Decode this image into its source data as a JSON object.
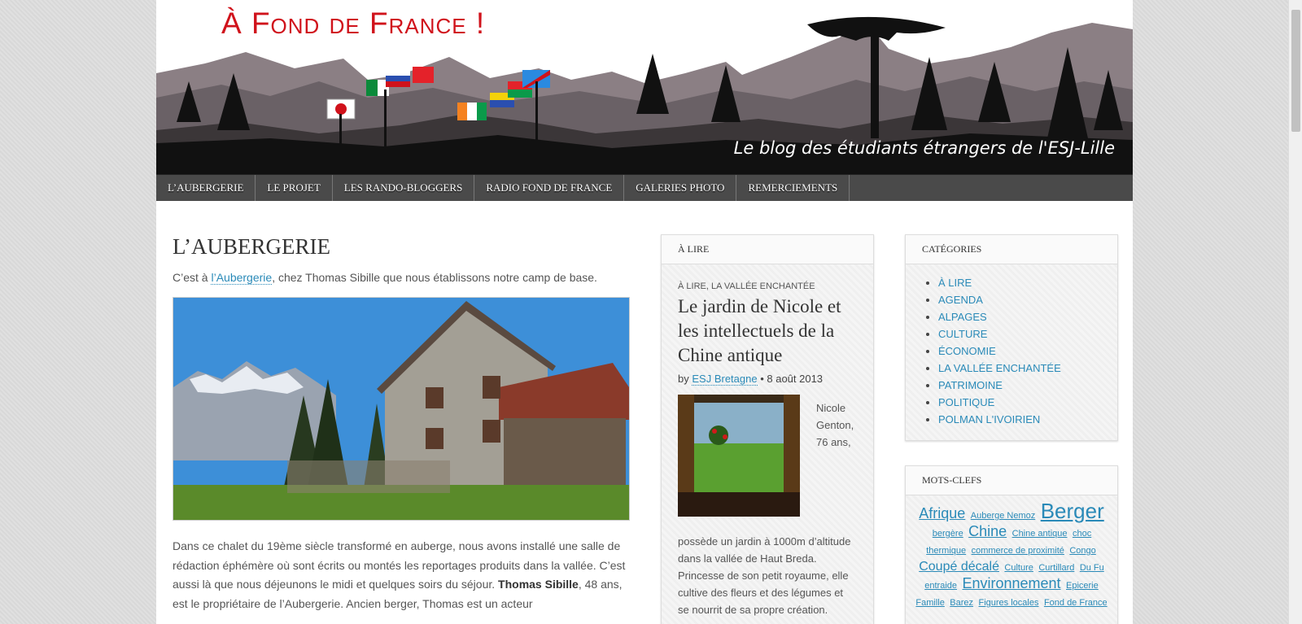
{
  "site": {
    "title": "À Fond de France !",
    "tagline": "Le blog des étudiants étrangers de l'ESJ-Lille"
  },
  "nav": [
    "L’AUBERGERIE",
    "LE PROJET",
    "LES RANDO-BLOGGERS",
    "RADIO FOND DE FRANCE",
    "GALERIES PHOTO",
    "REMERCIEMENTS"
  ],
  "article": {
    "title": "L’AUBERGERIE",
    "intro_before": "C’est à ",
    "intro_link": "l’Aubergerie",
    "intro_after": ", chez Thomas Sibille que nous établissons notre camp de base.",
    "body_1": "Dans ce chalet du 19ème siècle transformé en auberge, nous avons installé une salle de rédaction éphémère où sont écrits ou montés les reportages produits dans la vallée. C’est aussi là que nous déjeunons le midi et quelques soirs du séjour. ",
    "body_bold": "Thomas Sibille",
    "body_2": ", 48 ans, est le propriétaire de l’Aubergerie. Ancien berger, Thomas est un acteur"
  },
  "widget_lire": {
    "title": "À LIRE",
    "categories": "À LIRE, LA VALLÉE ENCHANTÉE",
    "post_title": "Le jardin de Nicole et les intellectuels de la Chine antique",
    "by": "by",
    "author": "ESJ Bretagne",
    "date": "• 8 août 2013",
    "excerpt_side": "Nicole Genton, 76 ans,",
    "excerpt_rest": "possède un jardin à 1000m d’altitude dans la vallée de Haut Breda. Princesse de son petit royaume, elle cultive des fleurs et des légumes et se nourrit de sa propre création."
  },
  "widget_categories": {
    "title": "CATÉGORIES",
    "items": [
      "À LIRE",
      "AGENDA",
      "ALPAGES",
      "CULTURE",
      "ÉCONOMIE",
      "LA VALLÉE ENCHANTÉE",
      "PATRIMOINE",
      "POLITIQUE",
      "POLMAN L'IVOIRIEN"
    ]
  },
  "widget_tags": {
    "title": "MOTS-CLEFS",
    "tags": [
      {
        "label": "Afrique",
        "size": 18
      },
      {
        "label": "Auberge Nemoz",
        "size": 11
      },
      {
        "label": "Berger",
        "size": 26
      },
      {
        "label": "bergère",
        "size": 11
      },
      {
        "label": "Chine",
        "size": 18
      },
      {
        "label": "Chine antique",
        "size": 11
      },
      {
        "label": "choc thermique",
        "size": 11
      },
      {
        "label": "commerce de proximité",
        "size": 11
      },
      {
        "label": "Congo",
        "size": 11
      },
      {
        "label": "Coupé décalé",
        "size": 16
      },
      {
        "label": "Culture",
        "size": 11
      },
      {
        "label": "Curtillard",
        "size": 11
      },
      {
        "label": "Du Fu",
        "size": 11
      },
      {
        "label": "entraide",
        "size": 11
      },
      {
        "label": "Environnement",
        "size": 18
      },
      {
        "label": "Epicerie",
        "size": 11
      },
      {
        "label": "Famille",
        "size": 11
      },
      {
        "label": "Barez",
        "size": 11
      },
      {
        "label": "Figures locales",
        "size": 11
      },
      {
        "label": "Fond de France",
        "size": 11
      }
    ]
  }
}
